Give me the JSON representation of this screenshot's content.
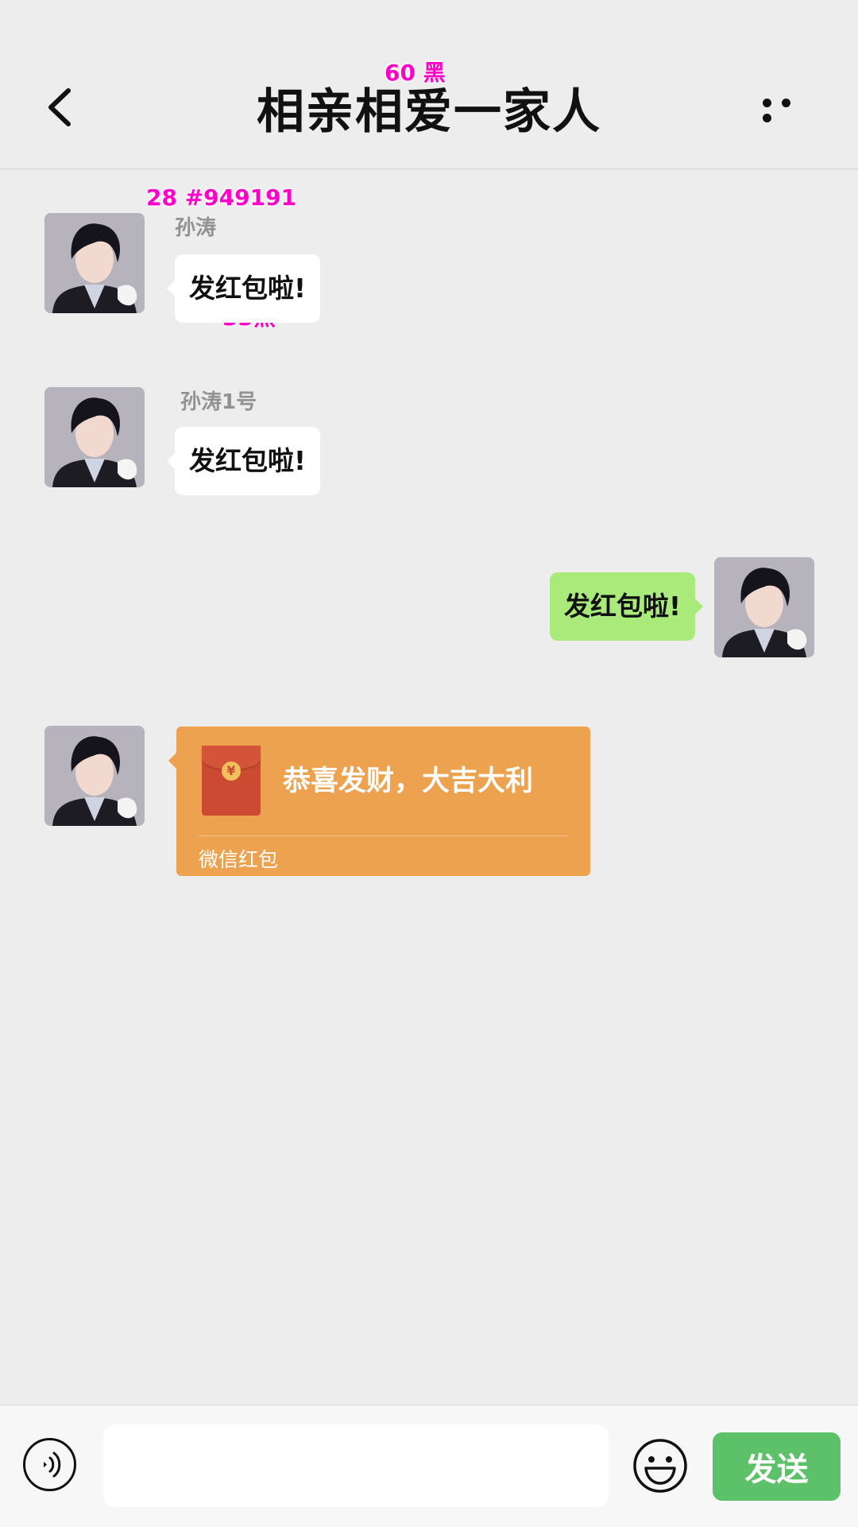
{
  "header": {
    "title": "相亲相爱一家人",
    "back_icon": "chevron-left-icon",
    "more_icon": "more-dots-icon"
  },
  "annotations": {
    "title_spec": "60 黑",
    "sender_spec": "28  #949191",
    "bubble_spec": "33黑"
  },
  "messages": [
    {
      "side": "left",
      "sender": "孙涛",
      "text": "发红包啦!"
    },
    {
      "side": "left",
      "sender": "孙涛1号",
      "text": "发红包啦!"
    },
    {
      "side": "right",
      "sender": "",
      "text": "发红包啦!"
    }
  ],
  "red_packet": {
    "title": "恭喜发财，大吉大利",
    "footer": "微信红包",
    "coin_symbol": "¥",
    "color": "#eca24f"
  },
  "input": {
    "value": "",
    "placeholder": ""
  },
  "toolbar": {
    "voice_icon": "voice-icon",
    "emoji_icon": "emoji-icon",
    "send_label": "发送",
    "send_color": "#5cc168"
  },
  "colors": {
    "background": "#ededed",
    "sender_name": "#949191",
    "my_bubble": "#a9ea7a"
  }
}
